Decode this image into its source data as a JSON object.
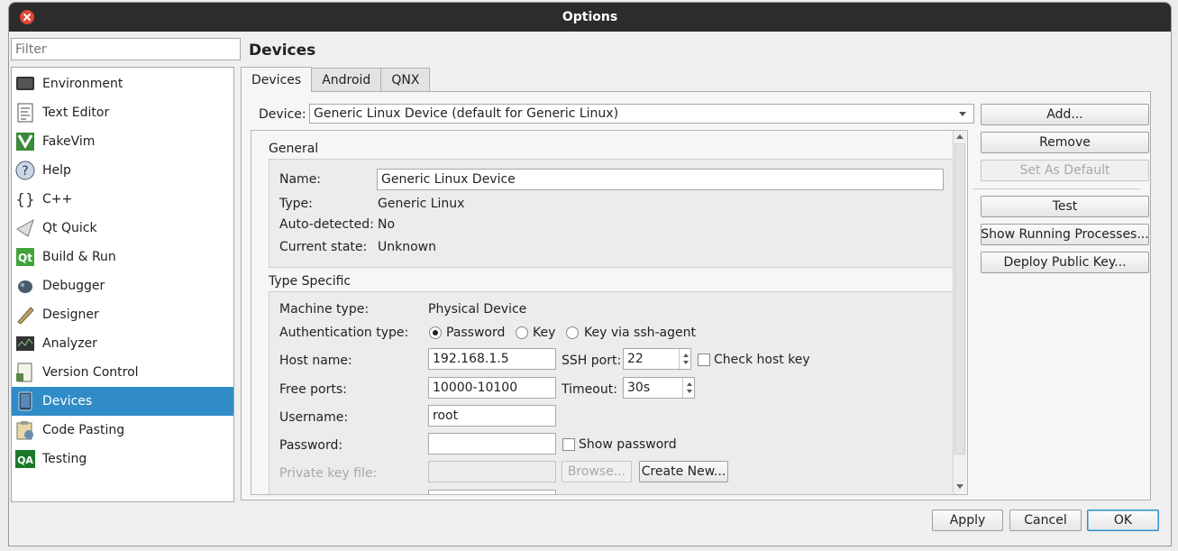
{
  "window": {
    "title": "Options"
  },
  "filter": {
    "placeholder": "Filter"
  },
  "sidebar": {
    "items": [
      {
        "label": "Environment",
        "icon": "monitor-icon"
      },
      {
        "label": "Text Editor",
        "icon": "text-editor-icon"
      },
      {
        "label": "FakeVim",
        "icon": "fakevim-icon"
      },
      {
        "label": "Help",
        "icon": "help-icon"
      },
      {
        "label": "C++",
        "icon": "cpp-braces-icon"
      },
      {
        "label": "Qt Quick",
        "icon": "qt-quick-icon"
      },
      {
        "label": "Build & Run",
        "icon": "build-run-icon"
      },
      {
        "label": "Debugger",
        "icon": "debugger-icon"
      },
      {
        "label": "Designer",
        "icon": "designer-icon"
      },
      {
        "label": "Analyzer",
        "icon": "analyzer-icon"
      },
      {
        "label": "Version Control",
        "icon": "version-control-icon"
      },
      {
        "label": "Devices",
        "icon": "device-icon",
        "selected": true
      },
      {
        "label": "Code Pasting",
        "icon": "code-pasting-icon"
      },
      {
        "label": "Testing",
        "icon": "qa-testing-icon"
      }
    ]
  },
  "page": {
    "title": "Devices"
  },
  "tabs": [
    {
      "label": "Devices"
    },
    {
      "label": "Android"
    },
    {
      "label": "QNX"
    }
  ],
  "device": {
    "label": "Device:",
    "value": "Generic Linux Device (default for Generic Linux)"
  },
  "actions": {
    "add": "Add...",
    "remove": "Remove",
    "set_default": "Set As Default",
    "test": "Test",
    "show_processes": "Show Running Processes...",
    "deploy_key": "Deploy Public Key..."
  },
  "general": {
    "heading": "General",
    "name_label": "Name:",
    "name_value": "Generic Linux Device",
    "type_label": "Type:",
    "type_value": "Generic Linux",
    "auto_label": "Auto-detected:",
    "auto_value": "No",
    "state_label": "Current state:",
    "state_value": "Unknown"
  },
  "specific": {
    "heading": "Type Specific",
    "machine_label": "Machine type:",
    "machine_value": "Physical Device",
    "auth_label": "Authentication type:",
    "auth_options": [
      "Password",
      "Key",
      "Key via ssh-agent"
    ],
    "host_label": "Host name:",
    "host_value": "192.168.1.5",
    "ssh_label": "SSH port:",
    "ssh_value": "22",
    "check_host_key": "Check host key",
    "ports_label": "Free ports:",
    "ports_value": "10000-10100",
    "timeout_label": "Timeout:",
    "timeout_value": "30s",
    "user_label": "Username:",
    "user_value": "root",
    "password_label": "Password:",
    "password_value": "",
    "show_password": "Show password",
    "keyfile_label": "Private key file:",
    "browse": "Browse...",
    "create_new": "Create New..."
  },
  "footer": {
    "apply": "Apply",
    "cancel": "Cancel",
    "ok": "OK"
  },
  "colors": {
    "selection": "#308cc6",
    "titlebar": "#2c2c2c",
    "close": "#e0473a"
  }
}
